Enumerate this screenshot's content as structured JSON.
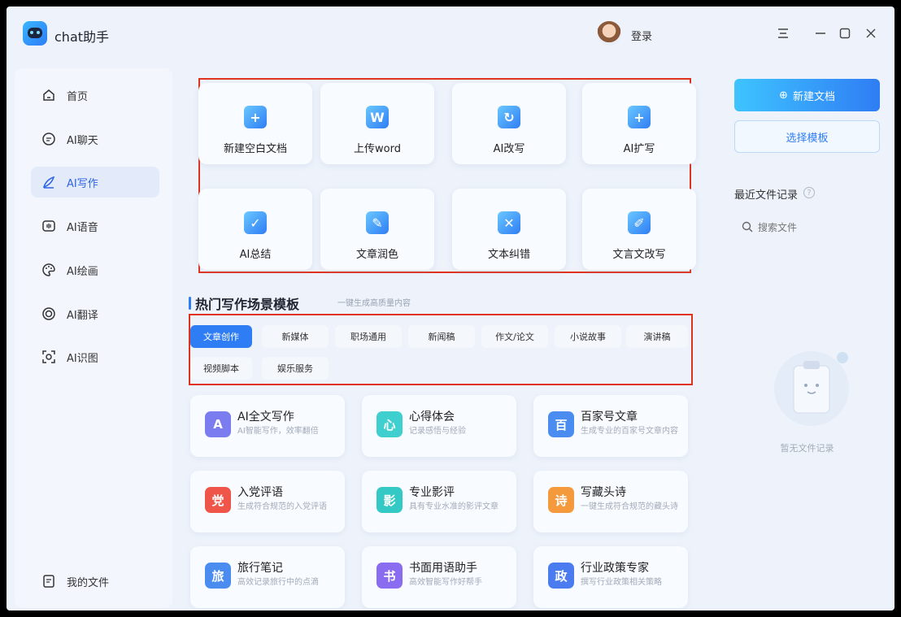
{
  "app": {
    "title": "chat助手"
  },
  "header": {
    "login": "登录",
    "menu_icon": "menu-icon",
    "minimize_icon": "minimize-icon",
    "maximize_icon": "maximize-icon",
    "close_icon": "close-icon"
  },
  "sidebar": {
    "items": [
      {
        "label": "首页",
        "icon": "home-icon"
      },
      {
        "label": "AI聊天",
        "icon": "chat-icon"
      },
      {
        "label": "AI写作",
        "icon": "pen-icon",
        "active": true
      },
      {
        "label": "AI语音",
        "icon": "voice-icon"
      },
      {
        "label": "AI绘画",
        "icon": "palette-icon"
      },
      {
        "label": "AI翻译",
        "icon": "translate-icon"
      },
      {
        "label": "AI识图",
        "icon": "scan-icon"
      }
    ],
    "my_files": "我的文件"
  },
  "tools": [
    {
      "label": "新建空白文档",
      "glyph": "+"
    },
    {
      "label": "上传word",
      "glyph": "W"
    },
    {
      "label": "AI改写",
      "glyph": "↻"
    },
    {
      "label": "AI扩写",
      "glyph": "+"
    },
    {
      "label": "AI总结",
      "glyph": "✓"
    },
    {
      "label": "文章润色",
      "glyph": "✎"
    },
    {
      "label": "文本纠错",
      "glyph": "✕"
    },
    {
      "label": "文言文改写",
      "glyph": "✐"
    }
  ],
  "section": {
    "title": "热门写作场景模板",
    "subtitle": "一键生成高质量内容"
  },
  "tabs": [
    "文章创作",
    "新媒体",
    "职场通用",
    "新闻稿",
    "作文/论文",
    "小说故事",
    "演讲稿",
    "视频脚本",
    "娱乐服务"
  ],
  "templates": [
    {
      "title": "AI全文写作",
      "desc": "AI智能写作，效率翻倍",
      "glyph": "A",
      "color": "#7a7cf0"
    },
    {
      "title": "心得体会",
      "desc": "记录感悟与经验",
      "glyph": "心",
      "color": "#3fcfcf"
    },
    {
      "title": "百家号文章",
      "desc": "生成专业的百家号文章内容",
      "glyph": "百",
      "color": "#4a8cf0"
    },
    {
      "title": "入党评语",
      "desc": "生成符合规范的入党评语",
      "glyph": "党",
      "color": "#f0554a"
    },
    {
      "title": "专业影评",
      "desc": "具有专业水准的影评文章",
      "glyph": "影",
      "color": "#34c9c4"
    },
    {
      "title": "写藏头诗",
      "desc": "一键生成符合规范的藏头诗",
      "glyph": "诗",
      "color": "#f59a3c"
    },
    {
      "title": "旅行笔记",
      "desc": "高效记录旅行中的点滴",
      "glyph": "旅",
      "color": "#4a8cf0"
    },
    {
      "title": "书面用语助手",
      "desc": "高效智能写作好帮手",
      "glyph": "书",
      "color": "#8a6cf0"
    },
    {
      "title": "行业政策专家",
      "desc": "撰写行业政策相关策略",
      "glyph": "政",
      "color": "#4a7cf0"
    }
  ],
  "right": {
    "new_doc": "新建文档",
    "choose_template": "选择模板",
    "recent_title": "最近文件记录",
    "search_placeholder": "搜索文件",
    "empty_text": "暂无文件记录"
  }
}
